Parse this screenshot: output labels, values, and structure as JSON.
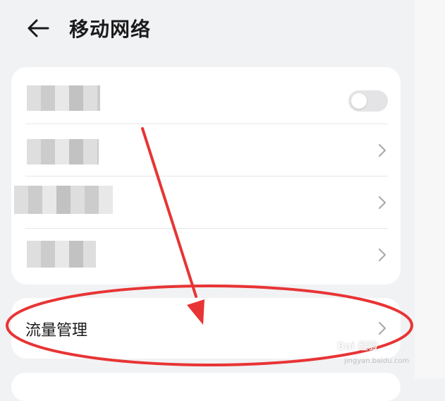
{
  "header": {
    "title": "移动网络"
  },
  "main_card": {
    "rows": [
      {
        "type": "toggle",
        "toggle_on": false
      },
      {
        "type": "link"
      },
      {
        "type": "link"
      },
      {
        "type": "link"
      }
    ]
  },
  "traffic_card": {
    "label": "流量管理"
  },
  "watermark": {
    "brand": "Bai 经验",
    "url": "jingyan.baidu.com"
  },
  "colors": {
    "annotation": "#e83434",
    "toggle_off": "#e4e4e6",
    "chevron": "#a7a7ab",
    "background": "#f1f2f4"
  },
  "icons": {
    "back": "arrow-left-icon",
    "chevron": "chevron-right-icon"
  }
}
